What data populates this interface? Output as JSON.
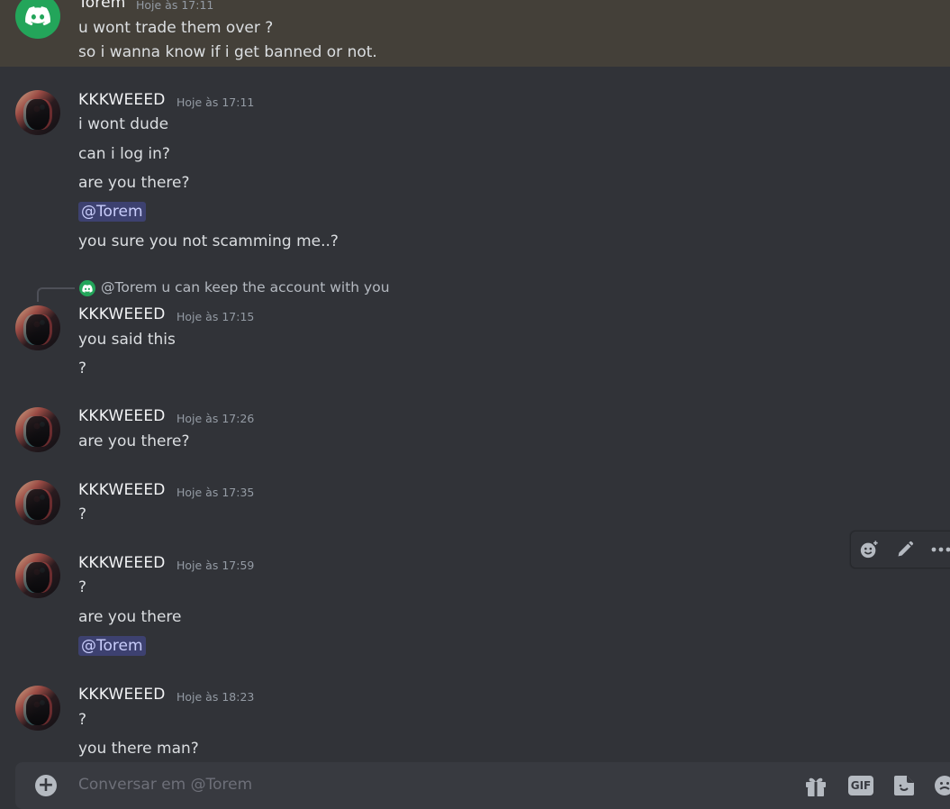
{
  "composer": {
    "placeholder": "Conversar em @Torem",
    "gif_label": "GIF"
  },
  "toolbar_icons": [
    "add-reaction-icon",
    "edit-icon",
    "more-icon"
  ],
  "messages": [
    {
      "author": "Torem",
      "time": "Hoje às 17:11",
      "lines": [
        "u wont trade them over ?",
        "so i wanna know if i get banned or not."
      ]
    },
    {
      "author": "KKKWEEED",
      "time": "Hoje às 17:11",
      "lines": [
        "i wont dude",
        "can i log in?",
        "are you there?",
        "@Torem",
        "you sure you not scamming me..?"
      ]
    },
    {
      "reply": {
        "mention": "@Torem",
        "text": "u can keep the account with you"
      },
      "author": "KKKWEEED",
      "time": "Hoje às 17:15",
      "lines": [
        "you said this",
        "?"
      ]
    },
    {
      "author": "KKKWEEED",
      "time": "Hoje às 17:26",
      "lines": [
        "are you there?"
      ]
    },
    {
      "author": "KKKWEEED",
      "time": "Hoje às 17:35",
      "lines": [
        "?"
      ]
    },
    {
      "author": "KKKWEEED",
      "time": "Hoje às 17:59",
      "lines": [
        "?",
        "are you there",
        "@Torem"
      ]
    },
    {
      "author": "KKKWEEED",
      "time": "Hoje às 18:23",
      "lines": [
        "?",
        "you there man?"
      ]
    }
  ]
}
